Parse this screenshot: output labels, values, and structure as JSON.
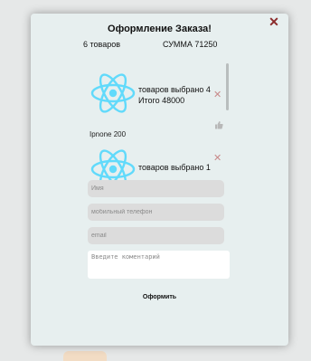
{
  "modal": {
    "title": "Оформление Заказа!",
    "close_icon": "close-icon",
    "summary": {
      "count_text": "6 товаров",
      "total_text": "СУММА 71250"
    }
  },
  "items": [
    {
      "icon": "react-logo-icon",
      "selected_text": "товаров выбрано 4",
      "total_text": "Итого 48000",
      "name": "Ipnone 200"
    },
    {
      "icon": "react-logo-icon",
      "selected_text": "товаров выбрано 1",
      "total_text": "",
      "name": ""
    }
  ],
  "form": {
    "name_placeholder": "Имя",
    "phone_placeholder": "мобильный телефон",
    "email_placeholder": "email",
    "comment_placeholder": "Введите коментарий",
    "submit_label": "Оформить"
  },
  "colors": {
    "react_logo": "#61dafb",
    "close_icon": "#8b2b2b",
    "remove_icon": "#c88a8a",
    "modal_background": "#e7efef"
  }
}
